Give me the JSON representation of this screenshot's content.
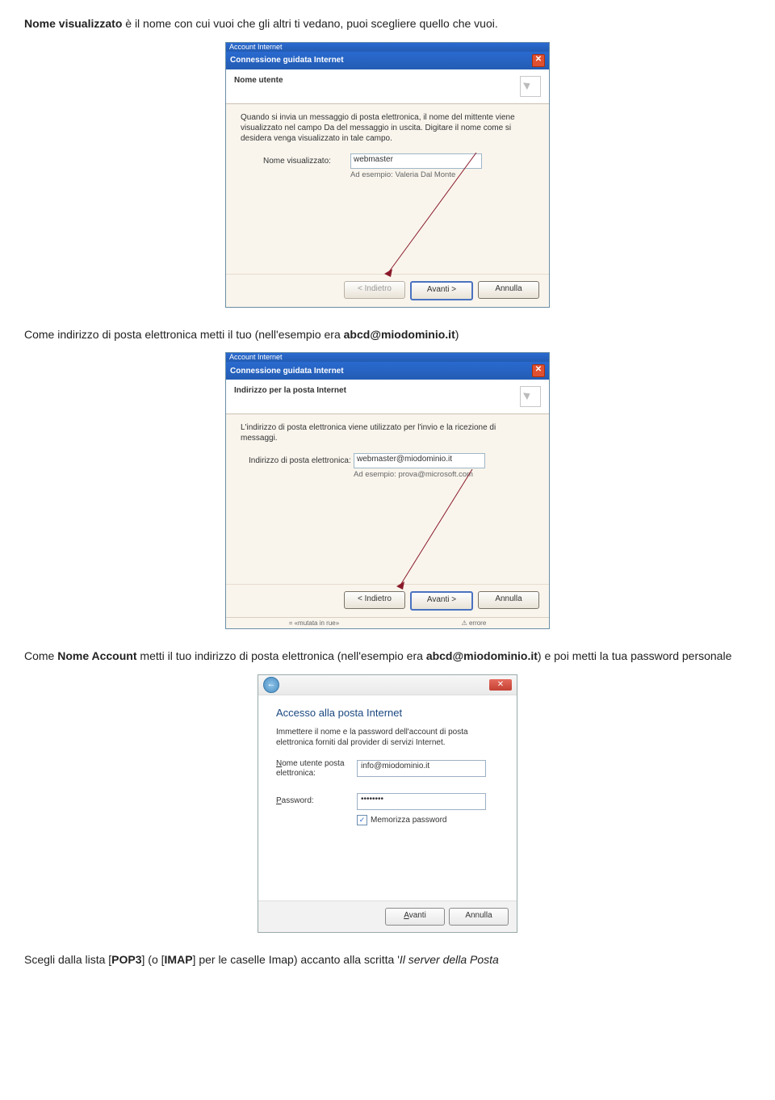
{
  "paragraphs": {
    "p1_a": "Nome visualizzato",
    "p1_b": " è il nome con cui vuoi che gli altri ti vedano, puoi scegliere quello che vuoi.",
    "p2_a": "Come indirizzo di posta elettronica metti il tuo (nell'esempio era ",
    "p2_b": "abcd@miodominio.it",
    "p2_c": ")",
    "p3_a": "Come ",
    "p3_b": "Nome Account",
    "p3_c": " metti il tuo indirizzo di posta elettronica (nell'esempio era ",
    "p3_d": "abcd@miodominio.it",
    "p3_e": ") e poi metti la tua password personale",
    "p4_a": "Scegli dalla lista [",
    "p4_b": "POP3",
    "p4_c": "] (o [",
    "p4_d": "IMAP",
    "p4_e": "] per le caselle Imap) accanto alla scritta '",
    "p4_f": "Il server della Posta"
  },
  "wizard1": {
    "strip": "Account Internet",
    "title": "Connessione guidata Internet",
    "header": "Nome utente",
    "description": "Quando si invia un messaggio di posta elettronica, il nome del mittente viene visualizzato nel campo Da del messaggio in uscita. Digitare il nome come si desidera venga visualizzato in tale campo.",
    "label": "Nome visualizzato:",
    "value": "webmaster",
    "example": "Ad esempio: Valeria Dal Monte",
    "back": "< Indietro",
    "next": "Avanti >",
    "cancel": "Annulla"
  },
  "wizard2": {
    "strip": "Account Internet",
    "title": "Connessione guidata Internet",
    "header": "Indirizzo per la posta Internet",
    "description": "L'indirizzo di posta elettronica viene utilizzato per l'invio e la ricezione di messaggi.",
    "label": "Indirizzo di posta elettronica:",
    "value": "webmaster@miodominio.it",
    "example": "Ad esempio: prova@microsoft.com",
    "back": "< Indietro",
    "next": "Avanti >",
    "cancel": "Annulla",
    "status1": "= «mutata in rue»",
    "status2": "⚠ errore"
  },
  "vista": {
    "sec_title": "Accesso alla posta Internet",
    "desc": "Immettere il nome e la password dell'account di posta elettronica forniti dal provider di servizi Internet.",
    "lab_user_u": "N",
    "lab_user_rest": "ome utente posta elettronica:",
    "user_value": "info@miodominio.it",
    "lab_pass_u": "P",
    "lab_pass_rest": "assword:",
    "pass_value": "••••••••",
    "chk_u": "M",
    "chk_rest": "emorizza password",
    "next_u": "A",
    "next_rest": "vanti",
    "cancel": "Annulla"
  }
}
